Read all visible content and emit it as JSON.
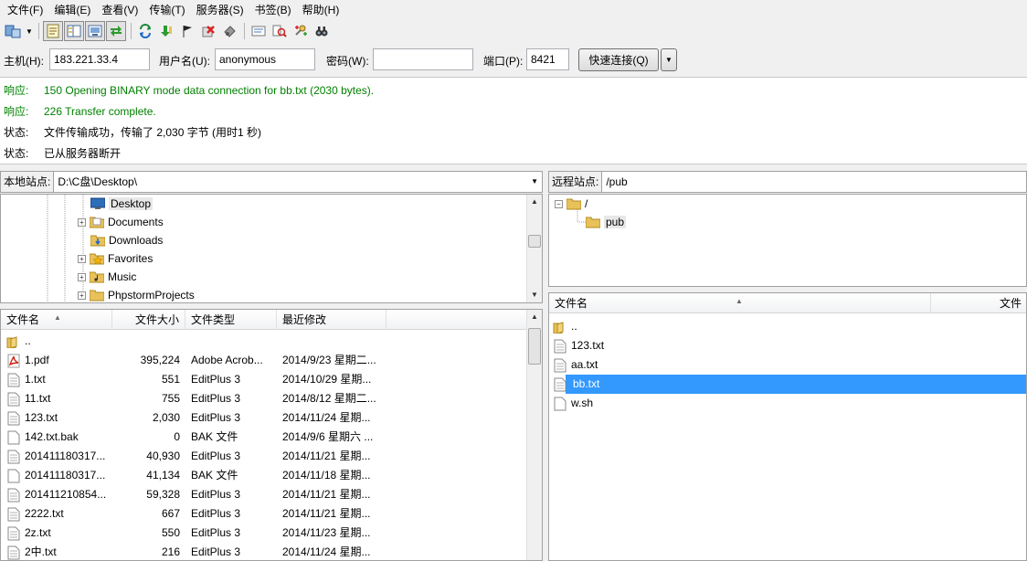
{
  "menu": [
    "文件(F)",
    "编辑(E)",
    "查看(V)",
    "传输(T)",
    "服务器(S)",
    "书签(B)",
    "帮助(H)"
  ],
  "toolbar_icons": [
    "site-manager-icon",
    "site-manager-dropdown-icon",
    "toggle-log-icon",
    "toggle-local-tree-icon",
    "toggle-remote-tree-icon",
    "toggle-queue-icon",
    "refresh-icon",
    "process-queue-icon",
    "cancel-icon",
    "disconnect-icon",
    "reconnect-icon",
    "filter-icon",
    "compare-icon",
    "sync-browse-icon",
    "search-icon"
  ],
  "quickconnect": {
    "host_label": "主机(H):",
    "host_value": "183.221.33.4",
    "user_label": "用户名(U):",
    "user_value": "anonymous",
    "pass_label": "密码(W):",
    "pass_value": "",
    "port_label": "端口(P):",
    "port_value": "8421",
    "connect_label": "快速连接(Q)"
  },
  "log": [
    {
      "kind": "响应:",
      "text": "150 Opening BINARY mode data connection for bb.txt (2030 bytes).",
      "color": "#008000"
    },
    {
      "kind": "响应:",
      "text": "226 Transfer complete.",
      "color": "#008000"
    },
    {
      "kind": "状态:",
      "text": "文件传输成功，传输了 2,030 字节 (用时1 秒)",
      "color": "#000000"
    },
    {
      "kind": "状态:",
      "text": "已从服务器断开",
      "color": "#000000"
    }
  ],
  "local": {
    "label": "本地站点:",
    "path": "D:\\C盘\\Desktop\\",
    "tree": [
      {
        "name": "Desktop",
        "icon": "desktop-icon",
        "expander": false,
        "selected": true
      },
      {
        "name": "Documents",
        "icon": "documents-icon",
        "expander": true
      },
      {
        "name": "Downloads",
        "icon": "downloads-icon",
        "expander": false
      },
      {
        "name": "Favorites",
        "icon": "favorites-icon",
        "expander": true
      },
      {
        "name": "Music",
        "icon": "music-icon",
        "expander": true
      },
      {
        "name": "PhpstormProjects",
        "icon": "folder-icon",
        "expander": true
      }
    ],
    "columns": [
      "文件名",
      "文件大小",
      "文件类型",
      "最近修改"
    ],
    "files": [
      {
        "name": "..",
        "size": "",
        "type": "",
        "modified": "",
        "icon": "folder-icon"
      },
      {
        "name": "1.pdf",
        "size": "395,224",
        "type": "Adobe Acrob...",
        "modified": "2014/9/23 星期二...",
        "icon": "pdf-icon"
      },
      {
        "name": "1.txt",
        "size": "551",
        "type": "EditPlus 3",
        "modified": "2014/10/29 星期...",
        "icon": "text-file-icon"
      },
      {
        "name": "11.txt",
        "size": "755",
        "type": "EditPlus 3",
        "modified": "2014/8/12 星期二...",
        "icon": "text-file-icon"
      },
      {
        "name": "123.txt",
        "size": "2,030",
        "type": "EditPlus 3",
        "modified": "2014/11/24 星期...",
        "icon": "text-file-icon"
      },
      {
        "name": "142.txt.bak",
        "size": "0",
        "type": "BAK 文件",
        "modified": "2014/9/6 星期六 ...",
        "icon": "file-icon"
      },
      {
        "name": "201411180317...",
        "size": "40,930",
        "type": "EditPlus 3",
        "modified": "2014/11/21 星期...",
        "icon": "text-file-icon"
      },
      {
        "name": "201411180317...",
        "size": "41,134",
        "type": "BAK 文件",
        "modified": "2014/11/18 星期...",
        "icon": "file-icon"
      },
      {
        "name": "201411210854...",
        "size": "59,328",
        "type": "EditPlus 3",
        "modified": "2014/11/21 星期...",
        "icon": "text-file-icon"
      },
      {
        "name": "2222.txt",
        "size": "667",
        "type": "EditPlus 3",
        "modified": "2014/11/21 星期...",
        "icon": "text-file-icon"
      },
      {
        "name": "2z.txt",
        "size": "550",
        "type": "EditPlus 3",
        "modified": "2014/11/23 星期...",
        "icon": "text-file-icon"
      },
      {
        "name": "2中.txt",
        "size": "216",
        "type": "EditPlus 3",
        "modified": "2014/11/24 星期...",
        "icon": "text-file-icon"
      }
    ]
  },
  "remote": {
    "label": "远程站点:",
    "path": "/pub",
    "tree": [
      {
        "name": "/",
        "icon": "folder-icon",
        "expander": true
      },
      {
        "name": "pub",
        "icon": "folder-icon",
        "expander": false,
        "selected": true
      }
    ],
    "columns": [
      "文件名",
      "文件"
    ],
    "files": [
      {
        "name": "..",
        "icon": "folder-icon"
      },
      {
        "name": "123.txt",
        "icon": "text-file-icon"
      },
      {
        "name": "aa.txt",
        "icon": "text-file-icon"
      },
      {
        "name": "bb.txt",
        "icon": "text-file-icon",
        "selected": true
      },
      {
        "name": "w.sh",
        "icon": "file-icon"
      }
    ]
  },
  "colors": {
    "selection": "#3399ff",
    "log_response": "#008000",
    "folder": "#e8c15a"
  }
}
